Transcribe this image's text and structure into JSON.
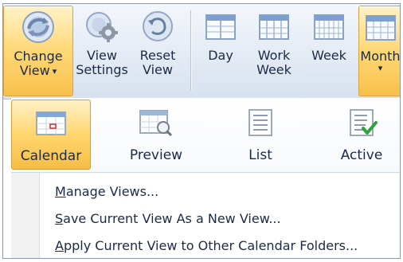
{
  "ribbon": {
    "buttons": [
      {
        "line1": "Change",
        "line2": "View",
        "has_arrow": true,
        "icon": "change-view-icon",
        "active": true
      },
      {
        "line1": "View",
        "line2": "Settings",
        "has_arrow": false,
        "icon": "view-settings-icon",
        "active": false
      },
      {
        "line1": "Reset",
        "line2": "View",
        "has_arrow": false,
        "icon": "reset-view-icon",
        "active": false
      },
      {
        "line1": "Day",
        "line2": "",
        "has_arrow": false,
        "icon": "calendar-day-icon",
        "active": false
      },
      {
        "line1": "Work",
        "line2": "Week",
        "has_arrow": false,
        "icon": "calendar-work-week-icon",
        "active": false
      },
      {
        "line1": "Week",
        "line2": "",
        "has_arrow": false,
        "icon": "calendar-week-icon",
        "active": false
      },
      {
        "line1": "Month",
        "line2": "",
        "has_arrow": true,
        "icon": "calendar-month-icon",
        "active": true
      }
    ]
  },
  "gallery": {
    "items": [
      {
        "label": "Calendar",
        "icon": "calendar-view-icon",
        "active": true
      },
      {
        "label": "Preview",
        "icon": "preview-view-icon",
        "active": false
      },
      {
        "label": "List",
        "icon": "list-view-icon",
        "active": false
      },
      {
        "label": "Active",
        "icon": "active-view-icon",
        "active": false
      }
    ]
  },
  "menu": {
    "items": [
      {
        "label": "Manage Views...",
        "underline": "M",
        "rest": "anage Views..."
      },
      {
        "label": "Save Current View As a New View...",
        "underline": "S",
        "rest": "ave Current View As a New View..."
      },
      {
        "label": "Apply Current View to Other Calendar Folders...",
        "underline": "A",
        "rest": "pply Current View to Other Calendar Folders..."
      }
    ]
  },
  "colors": {
    "ribbon_top": "#f3f6fb",
    "ribbon_bottom": "#d7e1ee",
    "active_highlight": "#ffd978",
    "text": "#1b2b45"
  }
}
